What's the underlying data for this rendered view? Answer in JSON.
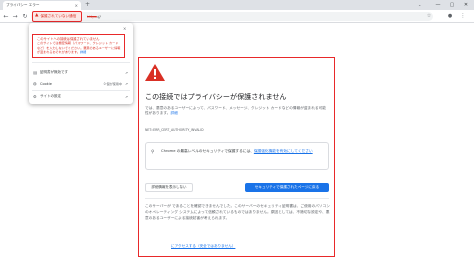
{
  "tab": {
    "title": "プライバシー エラー",
    "close_icon": "×",
    "new_tab_icon": "+"
  },
  "window": {
    "menu_icon": "⌄",
    "minimize_icon": "—",
    "maximize_icon": "▢",
    "close_icon": "✕"
  },
  "toolbar": {
    "back_icon": "←",
    "forward_icon": "→",
    "reload_icon": "↻",
    "security_label": "保護されていない通信",
    "warning_icon": "▲",
    "url_scheme": "https",
    "url_rest": "://",
    "star_icon": "☆",
    "profile_icon": "●",
    "menu_icon": "⋮"
  },
  "popup": {
    "close_icon": "×",
    "warning_title": "このサイトへの接続は保護されていません",
    "warning_body": "このサイトでは機密情報（パスワード、クレジット カードなど）を入力しないでください。悪意のあるユーザーに情報が盗まれるおそれがあります。",
    "warning_link": "詳細",
    "rows": [
      {
        "icon": "▤",
        "label": "証明書が無効です",
        "sub": "",
        "ext": "↗"
      },
      {
        "icon": "◍",
        "label": "Cookie",
        "sub": "0 個が使用中",
        "ext": "↗"
      },
      {
        "icon": "⚙",
        "label": "サイトの設定",
        "sub": "",
        "ext": "↗"
      }
    ]
  },
  "card": {
    "heading": "この接続ではプライバシーが保護されません",
    "paragraph": "では、悪意のあるユーザーによって、パスワード、メッセージ、クレジット カードなどの情報が盗まれる可能性があります。",
    "paragraph_link": "詳細",
    "error_code": "NET::ERR_CERT_AUTHORITY_INVALID",
    "protect_icon": "⚲",
    "protect_text": "Chrome の最高レベルのセキュリティで保護するには、",
    "protect_link": "保護強化機能を有効にしてください",
    "details_button": "詳細情報を表示しない",
    "back_button": "セキュリティで保護されたページに戻る",
    "details_text": "このサーバーが であることを確認できませんでした。このサーバーのセキュリティ証明書は、ご使用のパソコンのオペレーティング システムによって信頼されているものではありません。原因としては、不適切な設定や、悪意のあるユーザーによる接続妨害が考えられます。",
    "proceed_link": "にアクセスする（安全ではありません）"
  },
  "colors": {
    "alert_red": "#e8292a",
    "link_blue": "#1a73e8",
    "button_blue": "#1a73e8"
  }
}
